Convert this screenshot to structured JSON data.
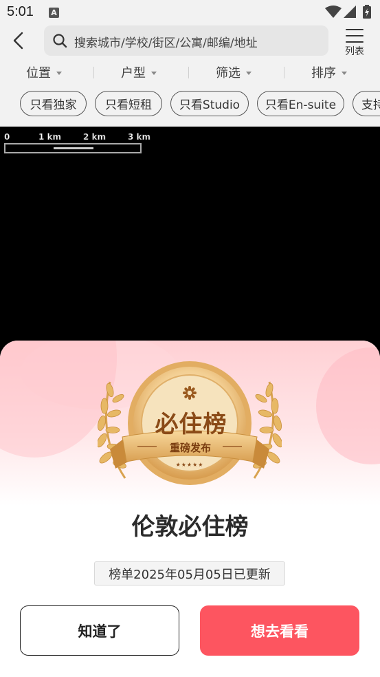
{
  "status_bar": {
    "time": "5:01",
    "notification_icon": "A"
  },
  "header": {
    "search_placeholder": "搜索城市/学校/街区/公寓/邮编/地址",
    "list_label": "列表"
  },
  "filters": [
    {
      "label": "位置"
    },
    {
      "label": "户型"
    },
    {
      "label": "筛选"
    },
    {
      "label": "排序"
    }
  ],
  "chips": [
    {
      "label": "只看独家"
    },
    {
      "label": "只看短租"
    },
    {
      "label": "只看Studio"
    },
    {
      "label": "只看En-suite"
    },
    {
      "label": "支持"
    }
  ],
  "map": {
    "scale_labels": [
      "0",
      "1 km",
      "2 km",
      "3 km"
    ]
  },
  "modal": {
    "badge_title": "必住榜",
    "badge_ribbon": "重磅发布",
    "badge_stars": "★★★★★",
    "title": "伦敦必住榜",
    "update_text": "榜单2025年05月05日已更新",
    "dismiss_label": "知道了",
    "go_label": "想去看看"
  },
  "colors": {
    "accent": "#fd5560",
    "badge_gold": "#e9b96e",
    "badge_text": "#8a4a17"
  }
}
